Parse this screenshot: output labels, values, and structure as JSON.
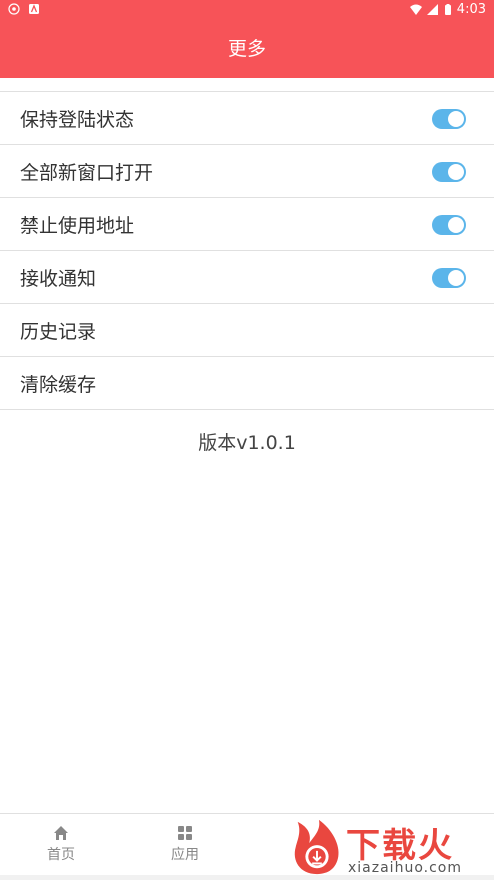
{
  "status_bar": {
    "time": "4:03",
    "left_icons": [
      "settings-circle-icon",
      "android-notification-icon"
    ],
    "right_icons": [
      "wifi-icon",
      "signal-icon",
      "battery-icon"
    ]
  },
  "header": {
    "title": "更多"
  },
  "settings": [
    {
      "label": "保持登陆状态",
      "toggle": true
    },
    {
      "label": "全部新窗口打开",
      "toggle": true
    },
    {
      "label": "禁止使用地址",
      "toggle": true
    },
    {
      "label": "接收通知",
      "toggle": true
    },
    {
      "label": "历史记录",
      "toggle": false
    },
    {
      "label": "清除缓存",
      "toggle": false
    }
  ],
  "version": "版本v1.0.1",
  "tabs": [
    {
      "label": "首页",
      "icon": "home-icon"
    },
    {
      "label": "应用",
      "icon": "grid-icon"
    }
  ],
  "watermark": {
    "brand": "下载火",
    "url": "xiazaihuo.com"
  },
  "colors": {
    "header": "#f75358",
    "toggle_on": "#5bb5ea"
  }
}
